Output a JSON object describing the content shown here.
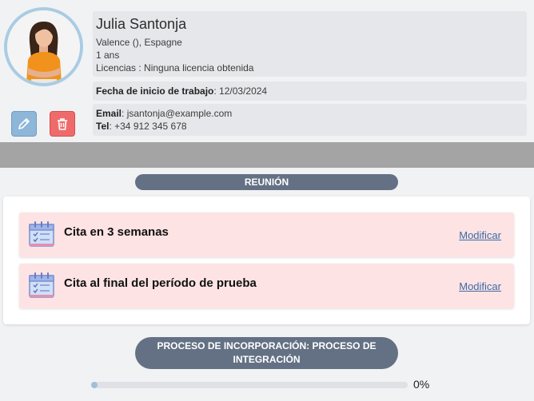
{
  "profile": {
    "name": "Julia Santonja",
    "location": "Valence (), Espagne",
    "seniority": "1 ans",
    "licenses": "Licencias : Ninguna licencia obtenida",
    "start_date_label": "Fecha de inicio de trabajo",
    "start_date_sep": ": ",
    "start_date": "12/03/2024",
    "email_label": "Email",
    "email_sep": ": ",
    "email": "jsantonja@example.com",
    "tel_label": "Tel",
    "tel_sep": ": ",
    "tel": "+34 912 345 678",
    "edit_icon": "pencil-icon",
    "delete_icon": "trash-icon"
  },
  "meeting": {
    "title": "REUNIÓN",
    "appointments": [
      {
        "title": "Cita en 3 semanas",
        "action": "Modificar",
        "icon": "calendar-icon"
      },
      {
        "title": "Cita al final del período de prueba",
        "action": "Modificar",
        "icon": "calendar-icon"
      }
    ]
  },
  "onboarding": {
    "title": "PROCESO DE INCORPORACIÓN: PROCESO DE INTEGRACIÓN",
    "progress_percent": 0,
    "progress_label": "0%"
  },
  "colors": {
    "pill": "#647184",
    "appointment_bg": "#fde3e4",
    "edit_button": "#8db6d9",
    "delete_button": "#ef6b6b",
    "divider": "#a4a4a4"
  }
}
